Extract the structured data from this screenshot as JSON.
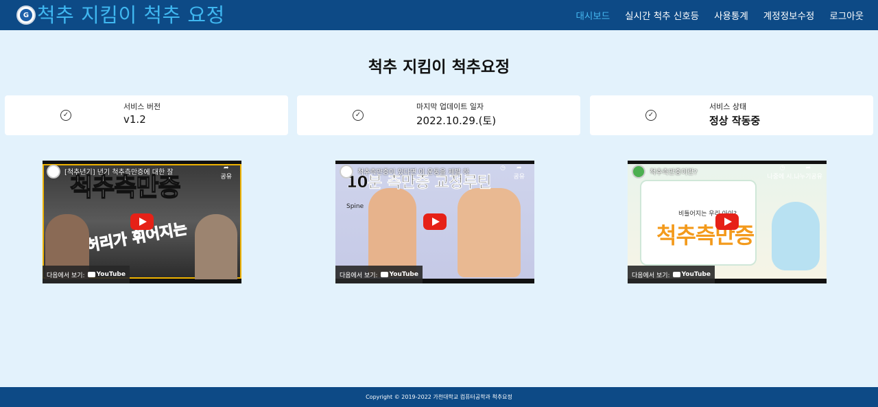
{
  "app": {
    "brand_title": "척추 지킴이 척추 요정",
    "logo_icon": "university-seal-icon"
  },
  "nav": {
    "items": [
      {
        "label": "대시보드",
        "active": true
      },
      {
        "label": "실시간 척추 신호등",
        "active": false
      },
      {
        "label": "사용통계",
        "active": false
      },
      {
        "label": "계정정보수정",
        "active": false
      },
      {
        "label": "로그아웃",
        "active": false
      }
    ]
  },
  "page": {
    "title": "척추 지킴이 척추요정"
  },
  "cards": [
    {
      "label": "서비스 버전",
      "value": "v1.2",
      "icon": "check-circle-icon"
    },
    {
      "label": "마지막 업데이트 일자",
      "value": "2022.10.29.(토)",
      "icon": "check-circle-icon"
    },
    {
      "label": "서비스 상태",
      "value": "정상 작동중",
      "icon": "check-circle-icon"
    }
  ],
  "videos": [
    {
      "title": "[척추년기] 년기 척추측만증에 대한 잘",
      "headline": "척추측만증",
      "subline": "허리가 휘어지는",
      "watch_on": "다음에서 보기:",
      "platform": "YouTube",
      "share": "공유"
    },
    {
      "title": "척추측만증이 있다면 이 운동을 제발 하",
      "headline": "10분 측만증 교정루틴",
      "subline": "Spine",
      "watch_on": "다음에서 보기:",
      "platform": "YouTube",
      "watch_later": "나중에 보기",
      "share": "공유"
    },
    {
      "title": "척추측만증이란?",
      "headline": "척추측만증",
      "subline": "비틀어지는 우리 아이?",
      "watch_on": "다음에서 보기:",
      "platform": "YouTube",
      "watch_later": "나중에 시...",
      "share": "나누기공유"
    }
  ],
  "footer": {
    "copyright": "Copyright © 2019-2022 가천대학교 컴퓨터공학과 척추요정"
  },
  "colors": {
    "navbar": "#0d4a86",
    "brand": "#3fb7f0",
    "background": "#e3f2fc",
    "active_nav": "#46b9f2",
    "youtube_red": "#e62117"
  }
}
